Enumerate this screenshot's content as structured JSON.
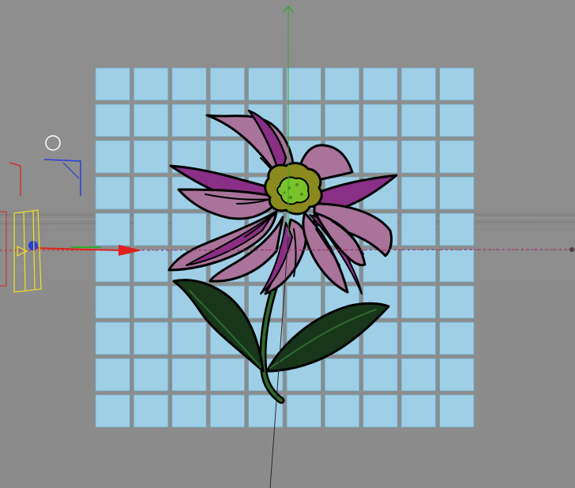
{
  "viewport": {
    "background": "#8e8e8e",
    "tile_grid": {
      "columns": 10,
      "rows": 10,
      "tile_color": "#9fcfe6",
      "tile_edge": "#6fa6c0"
    }
  },
  "flower": {
    "petal_color": "#a9739a",
    "petal_accent": "#8a2f86",
    "petal_overlap": "#9c3b52",
    "center_outer": "#8a8a1e",
    "center_inner": "#79c22a",
    "leaf_color": "#17361a",
    "leaf_vein": "#2d6a2d",
    "outline": "#000000"
  },
  "gizmo": {
    "axis_x_color": "#e02020",
    "axis_y_color": "#2fa82f",
    "axis_z_color": "#2a3fd6",
    "light_color": "#ffffff",
    "camera_color": "#f0e020"
  }
}
